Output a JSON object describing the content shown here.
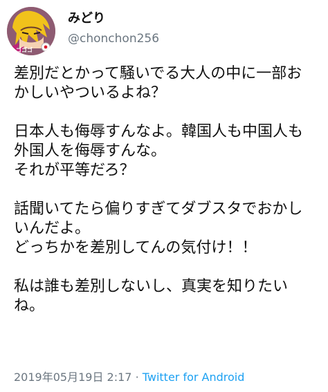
{
  "user": {
    "display_name": "みどり",
    "handle": "@chonchon256",
    "avatar_icon": "character-avatar-icon",
    "avatar_logo_text": "ゴゴゴ"
  },
  "tweet": {
    "text": "差別だとかって騒いでる大人の中に一部おかしいやついるよね？\n\n日本人も侮辱すんなよ。韓国人も中国人も外国人を侮辱すんな。\nそれが平等だろ？\n\n話聞いてたら偏りすぎてダブスタでおかしいんだよ。\nどっちかを差別してんの気付け！！\n\n私は誰も差別しないし、真実を知りたいね。"
  },
  "meta": {
    "timestamp": "2019年05月19日 2:17",
    "separator": "·",
    "source": "Twitter for Android"
  },
  "colors": {
    "text": "#111111",
    "muted": "#6b7680",
    "link": "#1da1f2"
  }
}
